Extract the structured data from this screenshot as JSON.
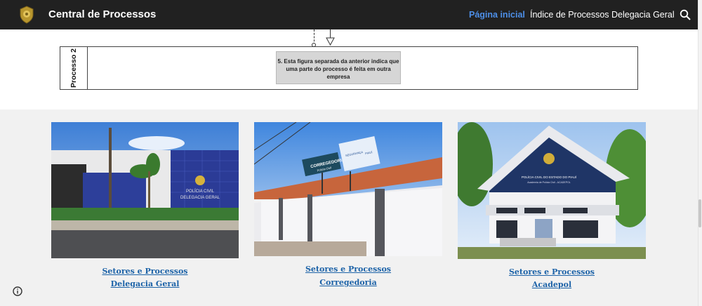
{
  "header": {
    "site_title": "Central de Processos",
    "logo_icon": "police-badge-icon",
    "nav": [
      {
        "label": "Página inicial",
        "active": true
      },
      {
        "label": "Índice de Processos",
        "active": false
      },
      {
        "label": "Delegacia Geral",
        "active": false
      }
    ],
    "search_icon": "search-icon",
    "active_color": "#4d8fe8",
    "background": "#212121"
  },
  "diagram": {
    "lane_label": "Processo 2",
    "note": "5. Esta figura separada da anterior indica que uma parte do processo é feita em outra empresa"
  },
  "cards": [
    {
      "line1": "Setores e Processos",
      "line2": "Delegacia Geral",
      "image_text": [
        "POLÍCIA CIVIL",
        "DELEGACIA GERAL"
      ]
    },
    {
      "line1": "Setores e Processos",
      "line2": "Corregedoria",
      "image_text": [
        "CORREGEDORIA",
        "Polícia Civil",
        "SEGURANÇA",
        "PIAUÍ"
      ]
    },
    {
      "line1": "Setores e Processos",
      "line2": "Acadepol",
      "image_text": [
        "POLÍCIA CIVIL DO ESTADO DO PIAUÍ",
        "Academia de Polícia Civil - ACADEPOL"
      ]
    }
  ],
  "footer": {
    "info_icon": "info-icon"
  },
  "colors": {
    "link": "#1d63a8",
    "page_bg": "#f1f1f1"
  }
}
